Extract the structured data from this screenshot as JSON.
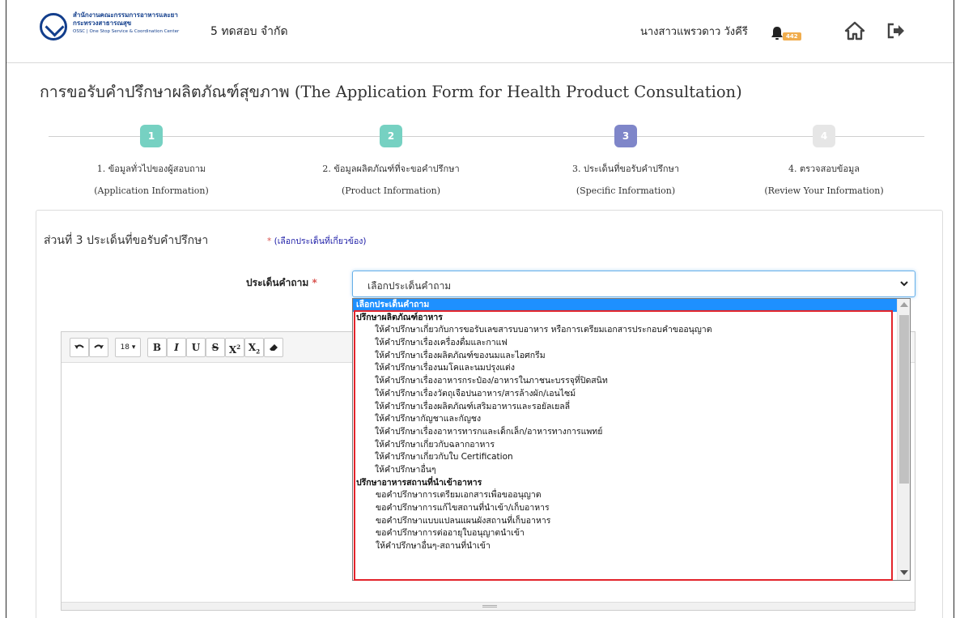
{
  "header": {
    "logo_line1": "สำนักงานคณะกรรมการอาหารและยา",
    "logo_line2": "กระทรวงสาธารณสุข",
    "logo_line3": "OSSC | One Stop Service & Coordination Center",
    "company": "5 ทดสอบ จำกัด",
    "user_name": "นางสาวแพรวดาว วังคีรี",
    "notification_count": "442"
  },
  "page_title": "การขอรับคำปรึกษาผลิตภัณฑ์สุขภาพ (The Application Form for Health Product Consultation)",
  "steps": [
    {
      "number": "1",
      "label": "1. ข้อมูลทั่วไปของผู้สอบถาม",
      "sub": "(Application Information)",
      "color": "#76d1c2"
    },
    {
      "number": "2",
      "label": "2. ข้อมูลผลิตภัณฑ์ที่จะขอคำปรึกษา",
      "sub": "(Product Information)",
      "color": "#76d1c2"
    },
    {
      "number": "3",
      "label": "3. ประเด็นที่ขอรับคำปรึกษา",
      "sub": "(Specific Information)",
      "color": "#7f86c9"
    },
    {
      "number": "4",
      "label": "4. ตรวจสอบข้อมูล",
      "sub": "(Review Your Information)",
      "color": "#e6e6e6"
    }
  ],
  "section": {
    "title": "ส่วนที่ 3 ประเด็นที่ขอรับคำปรึกษา",
    "note_star": "*",
    "note": "(เลือกประเด็นที่เกี่ยวข้อง)"
  },
  "question_field": {
    "label": "ประเด็นคำถาม",
    "required_mark": "*",
    "selected_value": "เลือกประเด็นคำถาม"
  },
  "editor": {
    "font_size": "18"
  },
  "dropdown_options": [
    {
      "text": "เลือกประเด็นคำถาม",
      "kind": "selected"
    },
    {
      "text": "ปรึกษาผลิตภัณฑ์อาหาร",
      "kind": "group"
    },
    {
      "text": "ให้คำปรึกษาเกี่ยวกับการขอรับเลขสารบบอาหาร หรือการเตรียมเอกสารประกอบคำขออนุญาต",
      "kind": "opt"
    },
    {
      "text": "ให้คำปรึกษาเรื่องเครื่องดื่มและกาแฟ",
      "kind": "opt"
    },
    {
      "text": "ให้คำปรึกษาเรื่องผลิตภัณฑ์ของนมและไอศกรีม",
      "kind": "opt"
    },
    {
      "text": "ให้คำปรึกษาเรื่องนมโคและนมปรุงแต่ง",
      "kind": "opt"
    },
    {
      "text": "ให้คำปรึกษาเรื่องอาหารกระป๋อง/อาหารในภาชนะบรรจุที่ปิดสนิท",
      "kind": "opt"
    },
    {
      "text": "ให้คำปรึกษาเรื่องวัตถุเจือปนอาหาร/สารล้างผัก/เอนไซม์",
      "kind": "opt"
    },
    {
      "text": "ให้คำปรึกษาเรื่องผลิตภัณฑ์เสริมอาหารและรอยัลเยลลี่",
      "kind": "opt"
    },
    {
      "text": "ให้คำปรึกษากัญชาและกัญชง",
      "kind": "opt"
    },
    {
      "text": "ให้คำปรึกษาเรื่องอาหารทารกและเด็กเล็ก/อาหารทางการแพทย์",
      "kind": "opt"
    },
    {
      "text": "ให้คำปรึกษาเกี่ยวกับฉลากอาหาร",
      "kind": "opt"
    },
    {
      "text": "ให้คำปรึกษาเกี่ยวกับใบ Certification",
      "kind": "opt"
    },
    {
      "text": "ให้คำปรึกษาอื่นๆ",
      "kind": "opt"
    },
    {
      "text": "ปรึกษาอาหารสถานที่นำเข้าอาหาร",
      "kind": "group"
    },
    {
      "text": "ขอคำปรึกษาการเตรียมเอกสารเพื่อขออนุญาต",
      "kind": "opt2"
    },
    {
      "text": "ขอคำปรึกษาการแก้ไขสถานที่นำเข้า/เก็บอาหาร",
      "kind": "opt2"
    },
    {
      "text": "ขอคำปรึกษาแบบแปลนแผนผังสถานที่เก็บอาหาร",
      "kind": "opt2"
    },
    {
      "text": "ขอคำปรึกษาการต่ออายุใบอนุญาตนำเข้า",
      "kind": "opt2"
    },
    {
      "text": "ให้คำปรึกษาอื่นๆ-สถานที่นำเข้า",
      "kind": "opt2"
    }
  ],
  "colors": {
    "highlight": "#e3242b",
    "selected_option": "#1e90ff",
    "link_note": "#1a1aa6"
  }
}
